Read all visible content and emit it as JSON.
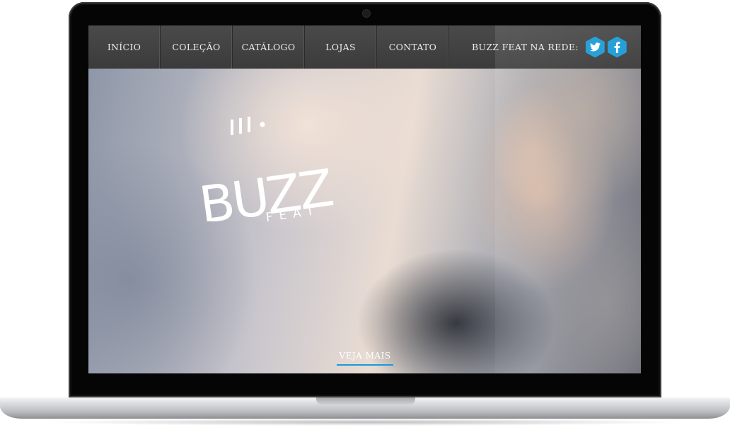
{
  "nav": {
    "items": [
      {
        "label": "INÍCIO"
      },
      {
        "label": "COLEÇÃO"
      },
      {
        "label": "CATÁLOGO"
      },
      {
        "label": "LOJAS"
      },
      {
        "label": "CONTATO"
      }
    ],
    "social_label": "BUZZ FEAT NA REDE:",
    "social_icons": [
      "twitter-icon",
      "facebook-icon"
    ]
  },
  "hero": {
    "logo_text": "BUZZ",
    "logo_subtext": "FEAT",
    "cta_label": "VEJA MAIS"
  },
  "colors": {
    "nav_background": "#3f3f3f",
    "accent": "#1b9ad6",
    "nav_text": "#ececec"
  }
}
